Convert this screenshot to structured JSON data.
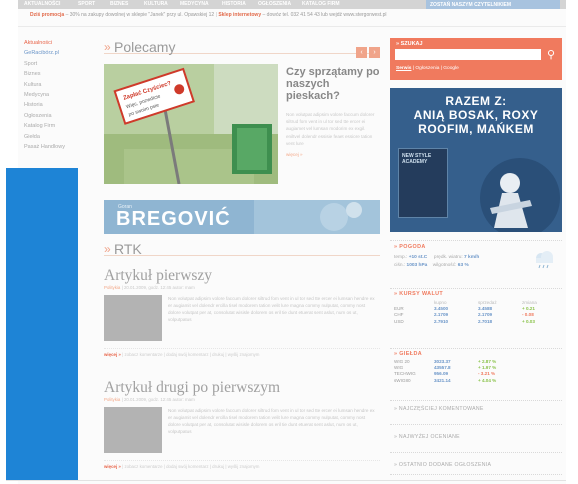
{
  "topnav": {
    "items": [
      "AKTUALNOŚCI",
      "SPORT",
      "BIZNES",
      "KULTURA",
      "MEDYCYNA",
      "HISTORIA",
      "OGŁOSZENIA",
      "KATALOG FIRM"
    ],
    "right": "ZOSTAŃ NASZYM CZYTELNIKIEM"
  },
  "promo": {
    "label": "Dziś promocja",
    "text": "– 30% na zakupy dowolnej w sklepie \"Janek\" przy ul. Opawskiej 12",
    "label2": "Sklep internetowy",
    "text2": "– dowóz tel. 032 41 54 43 lub wejdź www.stergorwest.pl"
  },
  "leftmenu": [
    {
      "label": "Aktualności",
      "style": "red"
    },
    {
      "label": "GeRacibórz.pl",
      "style": "blue"
    },
    {
      "label": "Sport",
      "style": ""
    },
    {
      "label": "Biznes",
      "style": ""
    },
    {
      "label": "Kultura",
      "style": ""
    },
    {
      "label": "Medycyna",
      "style": ""
    },
    {
      "label": "Historia",
      "style": ""
    },
    {
      "label": "Ogłoszenia",
      "style": ""
    },
    {
      "label": "Katalog Firm",
      "style": ""
    },
    {
      "label": "Giełda",
      "style": ""
    },
    {
      "label": "Pasaż Handlowy",
      "style": ""
    }
  ],
  "polecamy": {
    "raquo": "»",
    "title": "Polecamy",
    "prev": "‹",
    "next": "›",
    "featured_title": "Czy sprzątamy po naszych pieskach?",
    "featured_body": "Non volutpat adipsim volore faccum dolorer siltrud fom vent in ul tor sed tte ercer ei augiamet vel lumsan modorim ex exgil. eniltvel dolendr essisie feaet essiore tation vent lure",
    "featured_more": "więcej »",
    "sign_text": "Zapłać Czyściec? Więc, pozwólcie po swoim psie"
  },
  "banner": {
    "small": "Goran",
    "big": "BREGOVIĆ"
  },
  "rtk": {
    "raquo": "»",
    "title": "RTK"
  },
  "articles": [
    {
      "title": "Artykuł pierwszy",
      "author": "Politykia",
      "meta": "| 20.01.2009, godz. 12:45 autor: mam",
      "body": "Non volutpat adipsim volore faccum dolorer siltrud fom vent in ul tor sed tte ercer ei lumsan hendre ex er augiamit vel dolendr ercilla tisel modorem tation velit lure magna commy nulputat, commy nost dolore volutpat per at, consolutat wisisle dolorem os eril tie dunt etuerat sent aslut, num os ut, volputpatus",
      "links": [
        "więcej »",
        "| zobacz komentarze",
        "| dodaj swój komentarz",
        "| drukuj",
        "| wyślij znajomym"
      ]
    },
    {
      "title": "Artykuł drugi po pierwszym",
      "author": "Politykia",
      "meta": "| 20.01.2009, godz. 12:45 autor: mam",
      "body": "Non volutpat adipsim volore faccum dolorer siltrud fom vent in ul tor sed tte ercer ei lumsan hendre ex er augiamit vel dolendr ercilla tisel modorem tation velit lure magna commy nulputat, commy nost dolore volutpat per at, consolutat wisisle dolorem os eril tie dunt etuerat sent aslut, num os ut, volputpatus",
      "links": [
        "więcej »",
        "| zobacz komentarze",
        "| dodaj swój komentarz",
        "| drukuj",
        "| wyślij znajomym"
      ]
    }
  ],
  "search": {
    "title": "» SZUKAJ",
    "placeholder": "",
    "button": "⚲",
    "scopes_active": "Serwis",
    "scopes_rest": "| Ogłoszenia | Google"
  },
  "ad": {
    "line1": "RAZEM Z:",
    "line2": "ANIĄ BOSAK, ROXY",
    "line3": "ROOFIM, MAŃKEM",
    "mag": "NEW STYLE ACADEMY"
  },
  "weather": {
    "title": "» POGODA",
    "l1_label": "temp.:",
    "l1_val": "+10 st.C",
    "l1_label2": "prędk. wiatru:",
    "l1_val2": "7 km/h",
    "l2_label": "ciśn.:",
    "l2_val": "1003 hPa",
    "l2_label2": "wilgotność:",
    "l2_val2": "63 %"
  },
  "currencies": {
    "title": "» KURSY WALUT",
    "headers": [
      "",
      "kupno",
      "sprzedaż",
      "zmiana"
    ],
    "rows": [
      {
        "name": "EUR",
        "buy": "3.4500",
        "sell": "3.4588",
        "change": "+ 0.21",
        "dir": "up"
      },
      {
        "name": "CHF",
        "buy": "2.1709",
        "sell": "2.1709",
        "change": "- 0.08",
        "dir": "down"
      },
      {
        "name": "USD",
        "buy": "2.7910",
        "sell": "2.7018",
        "change": "+ 0.03",
        "dir": "up"
      }
    ]
  },
  "stocks": {
    "title": "» GIEŁDA",
    "rows": [
      {
        "name": "WIG 20",
        "val": "3023.37",
        "change": "+ 2.87 %",
        "dir": "up"
      },
      {
        "name": "WIG",
        "val": "43557.8",
        "change": "+ 1.97 %",
        "dir": "up"
      },
      {
        "name": "TECHWIG",
        "val": "956.09",
        "change": "- 3.21 %",
        "dir": "down"
      },
      {
        "name": "sWIG80",
        "val": "3421.14",
        "change": "+ 4.04 %",
        "dir": "up"
      }
    ]
  },
  "collapsed": [
    "» NAJCZĘŚCIEJ KOMENTOWANE",
    "» NAJWYŻEJ OCENIANE",
    "» OSTATNIO DODANE OGŁOSZENIA"
  ],
  "colors": {
    "accent": "#f07a5e",
    "blue_overlay": "#1e84d6",
    "link_blue": "#6a95c8"
  }
}
